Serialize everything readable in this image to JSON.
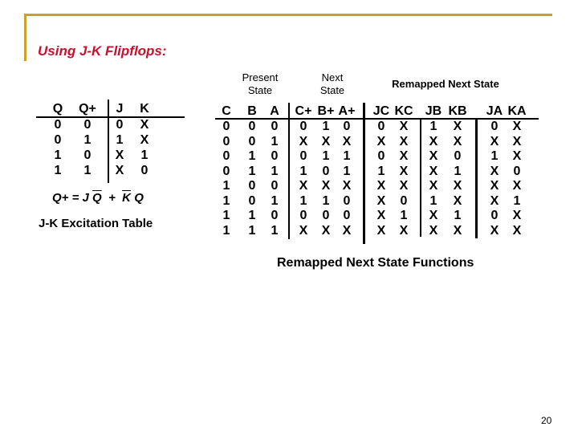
{
  "slide": {
    "title": "Using J-K Flipflops:",
    "page_number": "20",
    "accent_color": "#c8a02a",
    "title_color": "#c8102e"
  },
  "excitation_table": {
    "headers": [
      "Q",
      "Q+",
      "J",
      "K"
    ],
    "rows": [
      [
        "0",
        "0",
        "0",
        "X"
      ],
      [
        "0",
        "1",
        "1",
        "X"
      ],
      [
        "1",
        "0",
        "X",
        "1"
      ],
      [
        "1",
        "1",
        "X",
        "0"
      ]
    ],
    "equation": {
      "lhs": "Q+ = J",
      "term1_bar": "Q",
      "plus": "+",
      "term2_bar": "K",
      "term2_rest": "Q"
    },
    "caption": "J-K Excitation Table"
  },
  "state_table": {
    "group_labels": {
      "present_line1": "Present",
      "present_line2": "State",
      "next_line1": "Next",
      "next_line2": "State",
      "remapped": "Remapped Next State"
    },
    "headers": [
      "C",
      "B",
      "A",
      "C+",
      "B+",
      "A+",
      "JC",
      "KC",
      "JB",
      "KB",
      "JA",
      "KA"
    ],
    "rows": [
      [
        "0",
        "0",
        "0",
        "0",
        "1",
        "0",
        "0",
        "X",
        "1",
        "X",
        "0",
        "X"
      ],
      [
        "0",
        "0",
        "1",
        "X",
        "X",
        "X",
        "X",
        "X",
        "X",
        "X",
        "X",
        "X"
      ],
      [
        "0",
        "1",
        "0",
        "0",
        "1",
        "1",
        "0",
        "X",
        "X",
        "0",
        "1",
        "X"
      ],
      [
        "0",
        "1",
        "1",
        "1",
        "0",
        "1",
        "1",
        "X",
        "X",
        "1",
        "X",
        "0"
      ],
      [
        "1",
        "0",
        "0",
        "X",
        "X",
        "X",
        "X",
        "X",
        "X",
        "X",
        "X",
        "X"
      ],
      [
        "1",
        "0",
        "1",
        "1",
        "1",
        "0",
        "X",
        "0",
        "1",
        "X",
        "X",
        "1"
      ],
      [
        "1",
        "1",
        "0",
        "0",
        "0",
        "0",
        "X",
        "1",
        "X",
        "1",
        "0",
        "X"
      ],
      [
        "1",
        "1",
        "1",
        "X",
        "X",
        "X",
        "X",
        "X",
        "X",
        "X",
        "X",
        "X"
      ]
    ],
    "caption": "Remapped Next State Functions"
  }
}
